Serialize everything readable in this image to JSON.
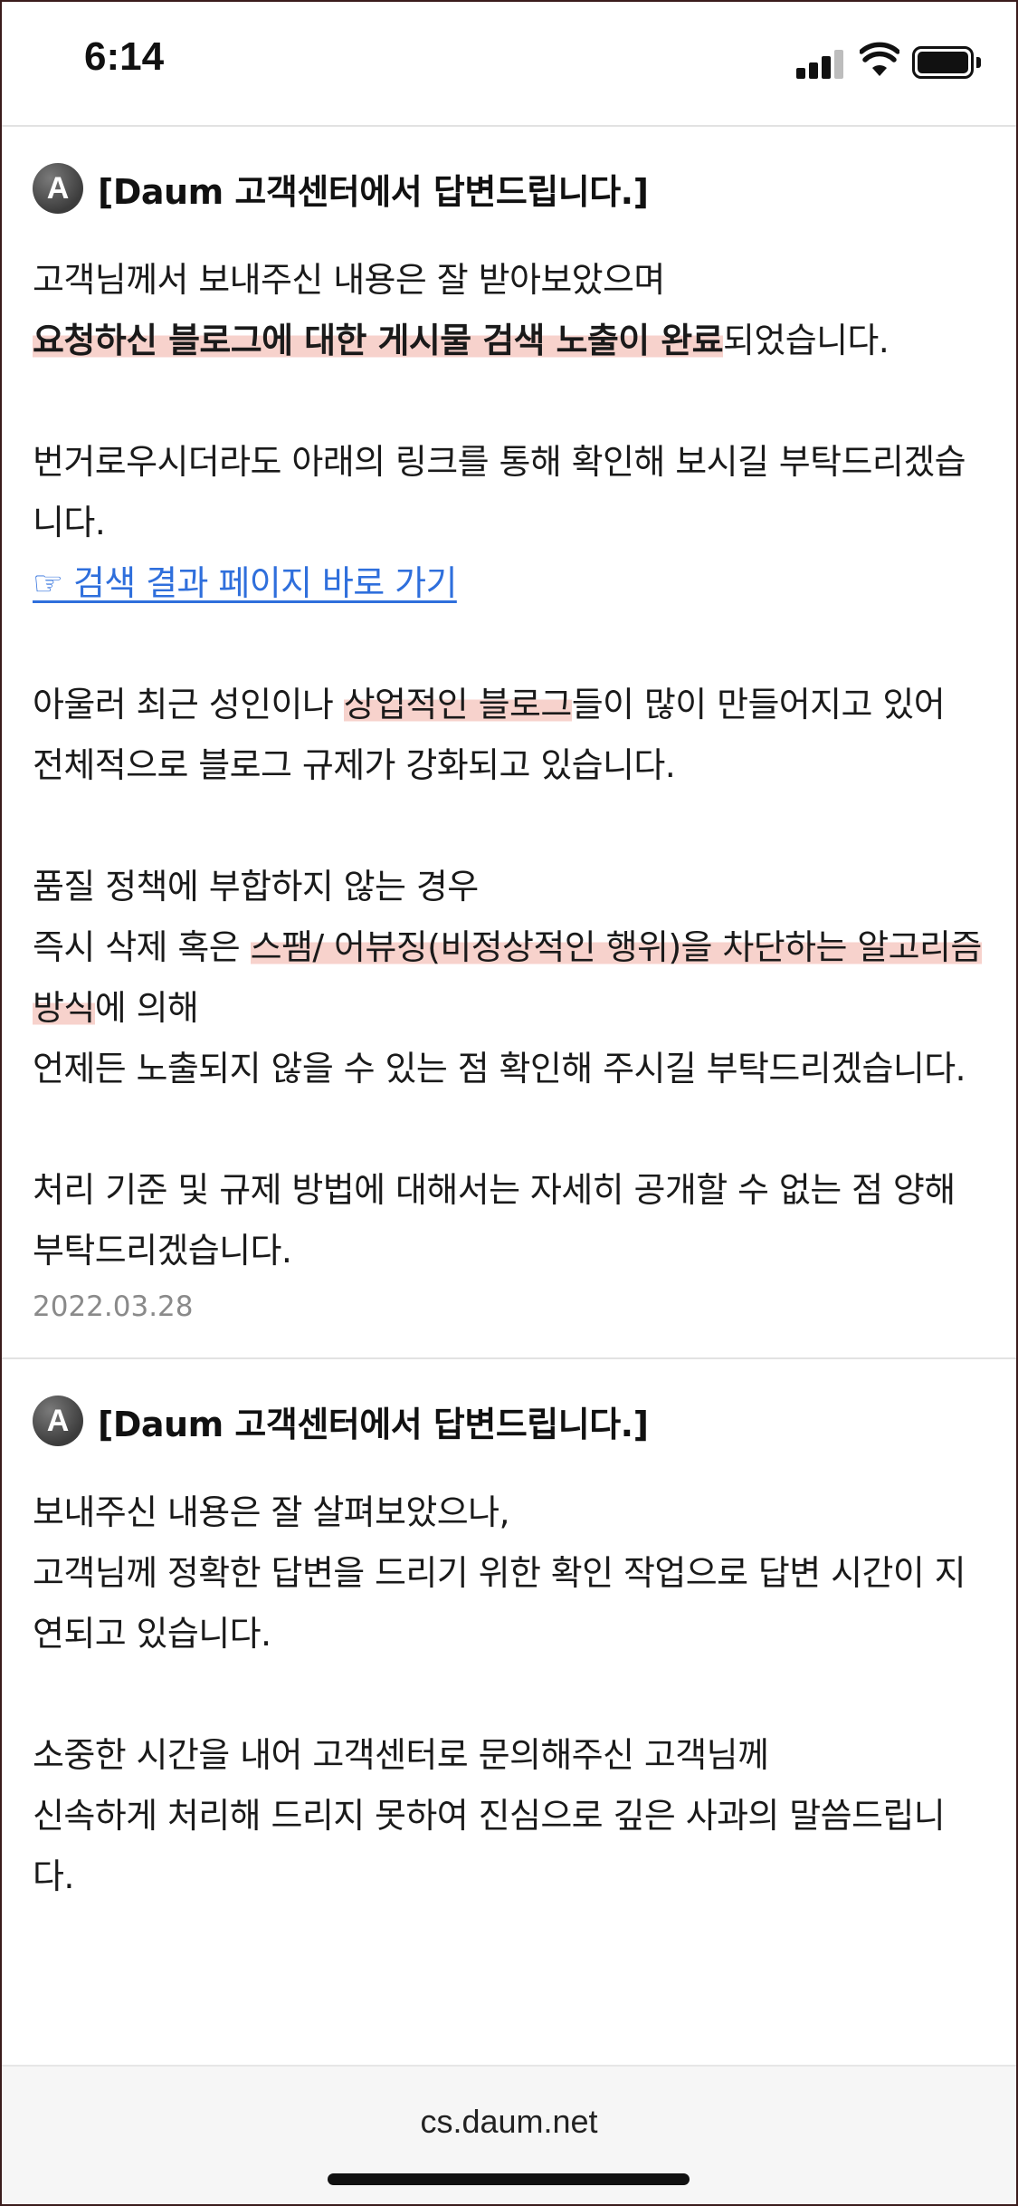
{
  "status_bar": {
    "time": "6:14"
  },
  "answers": [
    {
      "avatar_letter": "A",
      "title": "[Daum 고객센터에서 답변드립니다.]",
      "p1_line1": "고객님께서 보내주신 내용은 잘 받아보았으며",
      "p1_highlight": "요청하신 블로그에 대한 게시물 검색 노출이 완료",
      "p1_rest": "되었습니다.",
      "p2_text": "번거로우시더라도 아래의 링크를 통해 확인해 보시길 부탁드리겠습니다.",
      "link_text": "☞ 검색 결과 페이지 바로 가기",
      "p3_before": "아울러 최근 성인이나 ",
      "p3_highlight": "상업적인 블로그",
      "p3_after": "들이 많이 만들어지고 있어",
      "p3_line2": "전체적으로 블로그 규제가 강화되고 있습니다.",
      "p4_line1": "품질 정책에 부합하지 않는 경우",
      "p4_before": "즉시 삭제 혹은 ",
      "p4_highlight": "스팸/ 어뷰징(비정상적인 행위)을 차단하는 알고리즘 방식",
      "p4_after": "에 의해",
      "p4_line3": "언제든 노출되지 않을 수 있는 점 확인해 주시길 부탁드리겠습니다.",
      "p5_text": "처리 기준 및 규제 방법에 대해서는 자세히 공개할 수 없는 점 양해 부탁드리겠습니다.",
      "date": "2022.03.28"
    },
    {
      "avatar_letter": "A",
      "title": "[Daum 고객센터에서 답변드립니다.]",
      "p1_line1": "보내주신 내용은 잘 살펴보았으나,",
      "p1_line2": "고객님께 정확한 답변을 드리기 위한 확인 작업으로 답변 시간이 지연되고 있습니다.",
      "p2_line1": "소중한 시간을 내어 고객센터로 문의해주신 고객님께",
      "p2_line2": "신속하게 처리해 드리지 못하여 진심으로 깊은 사과의 말씀드립니다."
    }
  ],
  "browser": {
    "url": "cs.daum.net"
  },
  "colors": {
    "highlight": "#f7d2cc",
    "link": "#2f6fdc",
    "divider": "#e2e2e2"
  }
}
